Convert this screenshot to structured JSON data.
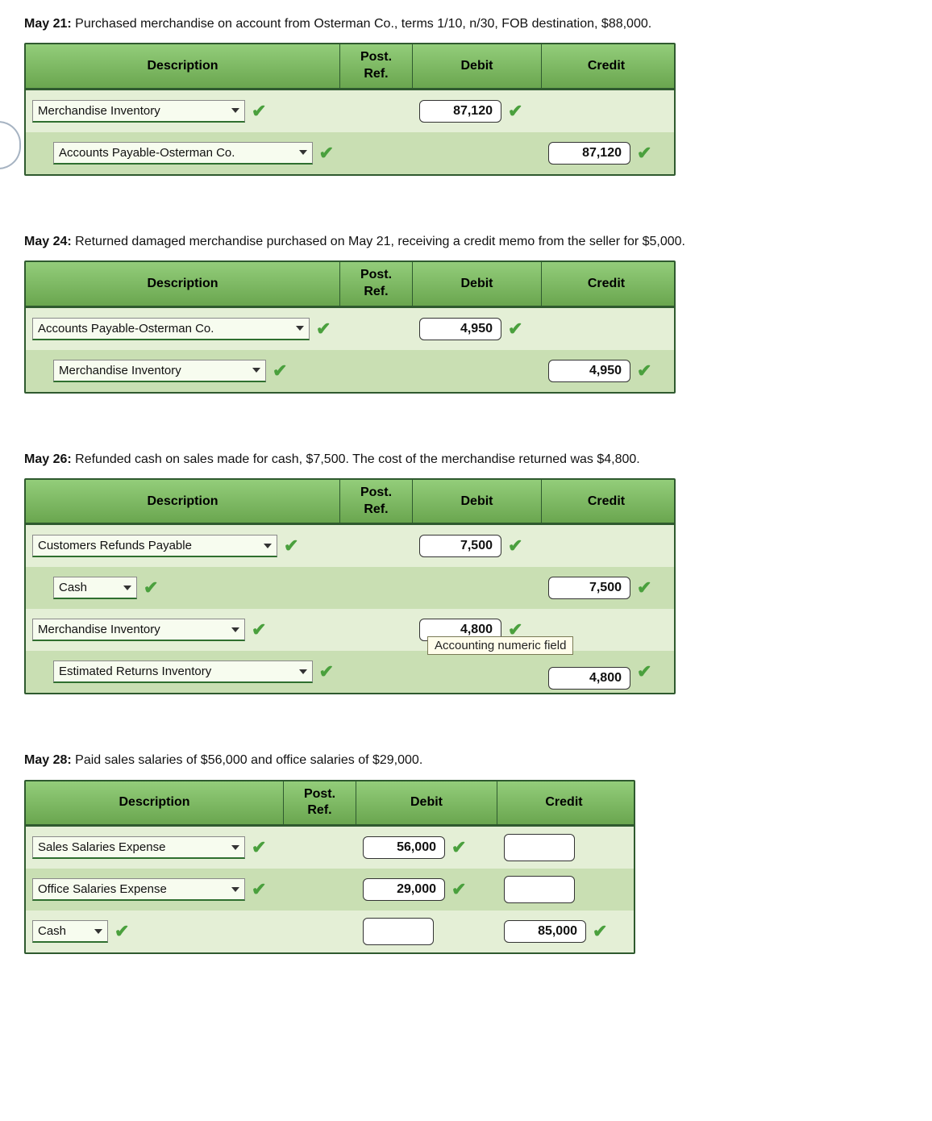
{
  "headers": {
    "description": "Description",
    "post_ref": "Post. Ref.",
    "debit": "Debit",
    "credit": "Credit"
  },
  "tooltip": "Accounting numeric field",
  "entries": [
    {
      "date": "May 21:",
      "text": "Purchased merchandise on account from Osterman Co., terms 1/10, n/30, FOB destination, $88,000.",
      "desc_w": 390,
      "post_w": 90,
      "deb_w": 160,
      "cred_w": 160,
      "rows": [
        {
          "indent": 0,
          "acct": "Merchandise Inventory",
          "acct_w": 250,
          "debit": "87,120",
          "credit": ""
        },
        {
          "indent": 1,
          "acct": "Accounts Payable-Osterman Co.",
          "acct_w": 330,
          "debit": "",
          "credit": "87,120"
        }
      ]
    },
    {
      "date": "May 24:",
      "text": "Returned damaged merchandise purchased on May 21, receiving a credit memo from the seller for $5,000.",
      "desc_w": 390,
      "post_w": 90,
      "deb_w": 160,
      "cred_w": 160,
      "rows": [
        {
          "indent": 0,
          "acct": "Accounts Payable-Osterman Co.",
          "acct_w": 330,
          "debit": "4,950",
          "credit": ""
        },
        {
          "indent": 1,
          "acct": "Merchandise Inventory",
          "acct_w": 250,
          "debit": "",
          "credit": "4,950"
        }
      ]
    },
    {
      "date": "May 26:",
      "text": "Refunded cash on sales made for cash, $7,500. The cost of the merchandise returned was $4,800.",
      "desc_w": 390,
      "post_w": 90,
      "deb_w": 160,
      "cred_w": 160,
      "rows": [
        {
          "indent": 0,
          "acct": "Customers Refunds Payable",
          "acct_w": 290,
          "debit": "7,500",
          "credit": ""
        },
        {
          "indent": 1,
          "acct": "Cash",
          "acct_w": 90,
          "debit": "",
          "credit": "7,500"
        },
        {
          "indent": 0,
          "acct": "Merchandise Inventory",
          "acct_w": 250,
          "debit": "4,800",
          "credit": ""
        },
        {
          "indent": 1,
          "acct": "Estimated Returns Inventory",
          "acct_w": 310,
          "debit": "",
          "credit": "4,800",
          "tooltip": true
        }
      ]
    },
    {
      "date": "May 28:",
      "text": "Paid sales salaries of $56,000 and office salaries of $29,000.",
      "desc_w": 320,
      "post_w": 90,
      "deb_w": 175,
      "cred_w": 165,
      "rows": [
        {
          "indent": 0,
          "acct": "Sales Salaries Expense",
          "acct_w": 250,
          "debit": "56,000",
          "credit": "",
          "credit_blank": true
        },
        {
          "indent": 0,
          "acct": "Office Salaries Expense",
          "acct_w": 250,
          "debit": "29,000",
          "credit": "",
          "credit_blank": true
        },
        {
          "indent": 0,
          "acct": "Cash",
          "acct_w": 80,
          "debit": "",
          "debit_blank": true,
          "credit": "85,000"
        }
      ]
    }
  ]
}
